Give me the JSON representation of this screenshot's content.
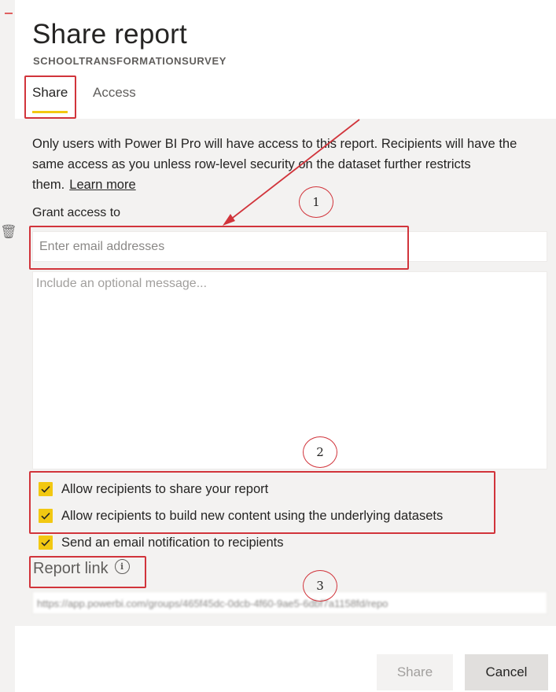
{
  "dialog": {
    "title": "Share report",
    "subtitle": "SCHOOLTRANSFORMATIONSURVEY",
    "tabs": [
      {
        "label": "Share",
        "active": true
      },
      {
        "label": "Access",
        "active": false
      }
    ],
    "info_text": "Only users with Power BI Pro will have access to this report. Recipients will have the same access as you unless row-level security on the dataset further restricts them.",
    "learn_more": "Learn more",
    "grant_label": "Grant access to",
    "email_placeholder": "Enter email addresses",
    "message_placeholder": "Include an optional message...",
    "options": [
      {
        "label": "Allow recipients to share your report",
        "checked": true
      },
      {
        "label": "Allow recipients to build new content using the underlying datasets",
        "checked": true
      },
      {
        "label": "Send an email notification to recipients",
        "checked": true
      }
    ],
    "report_link_label": "Report link",
    "report_link_value": "https://app.powerbi.com/groups/465f45dc-0dcb-4f60-9ae5-6dbf7a1158fd/repo",
    "buttons": {
      "share": "Share",
      "cancel": "Cancel"
    }
  },
  "annotations": {
    "badges": [
      "1",
      "2",
      "3"
    ]
  },
  "colors": {
    "accent": "#f2c811",
    "annotation": "#d1343b",
    "body_background": "#f3f2f1"
  },
  "icons": {
    "info": "info-icon",
    "check": "checkmark-icon",
    "trash": "trash-icon"
  }
}
